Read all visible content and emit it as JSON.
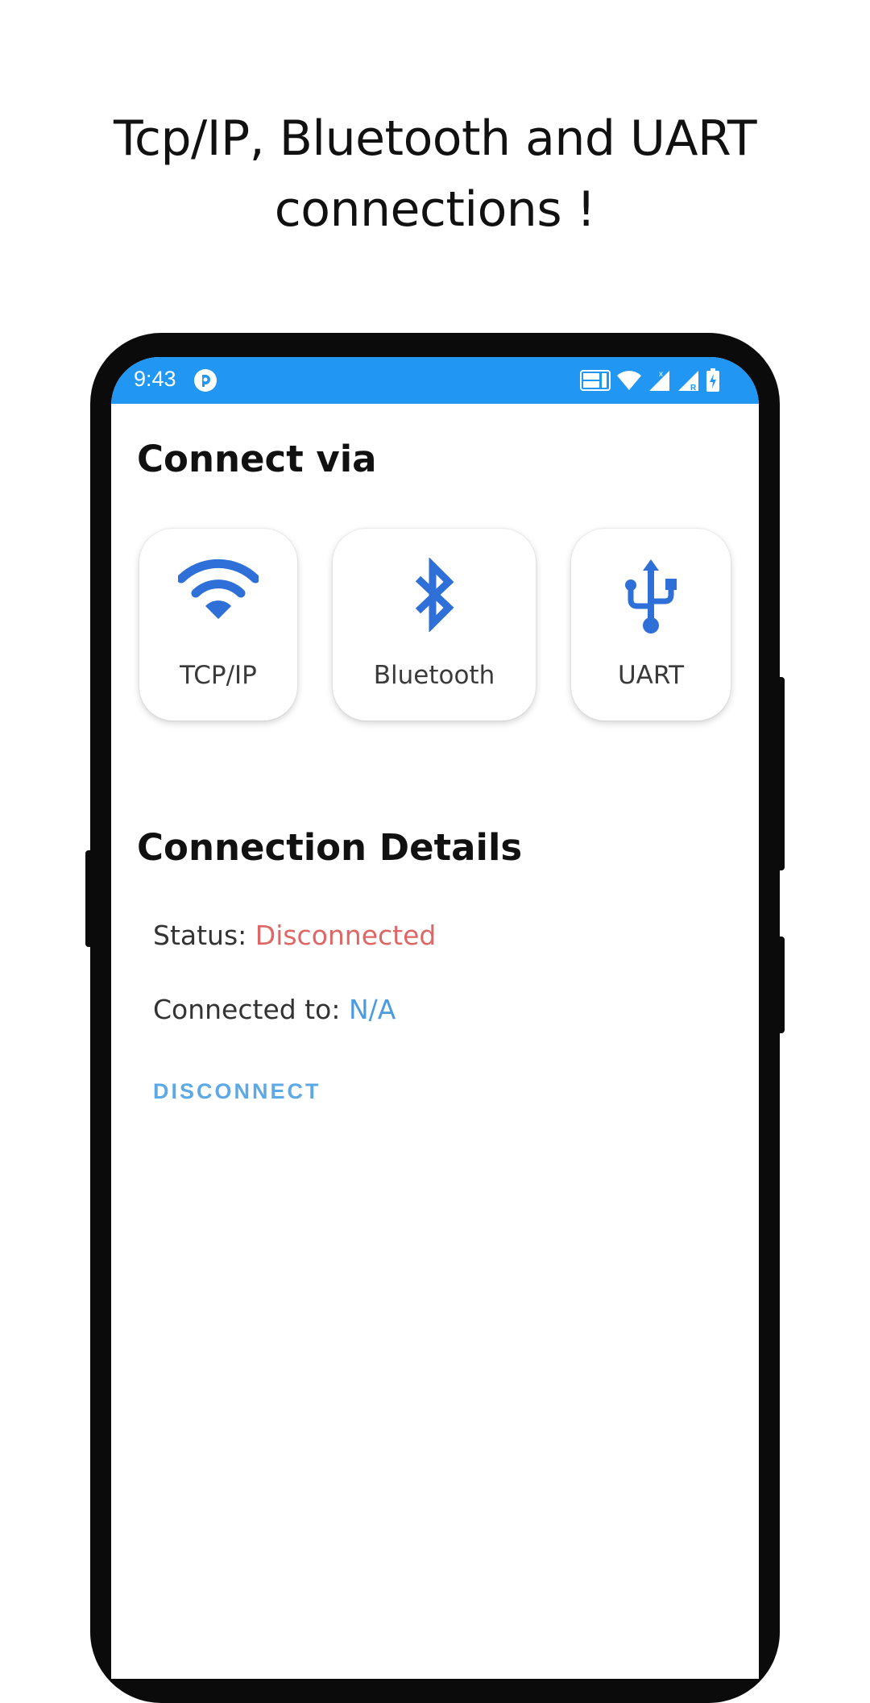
{
  "promo": {
    "line1": "Tcp/IP, Bluetooth and UART",
    "line2": "connections !"
  },
  "status_bar": {
    "time": "9:43",
    "background_color": "#2196f3",
    "icons": [
      "app-notification-icon",
      "volte-icon",
      "wifi-icon",
      "signal-icon",
      "signal-roaming-icon",
      "battery-charging-icon"
    ]
  },
  "connect_via": {
    "title": "Connect via",
    "options": [
      {
        "label": "TCP/IP",
        "icon": "wifi-icon"
      },
      {
        "label": "Bluetooth",
        "icon": "bluetooth-icon"
      },
      {
        "label": "UART",
        "icon": "usb-icon"
      }
    ],
    "icon_color": "#2f6fd8"
  },
  "connection_details": {
    "title": "Connection Details",
    "status_label": "Status:",
    "status_value": "Disconnected",
    "status_color": "#e06666",
    "connected_to_label": "Connected to:",
    "connected_to_value": "N/A",
    "connected_to_color": "#4a9be0",
    "disconnect_label": "DISCONNECT"
  }
}
